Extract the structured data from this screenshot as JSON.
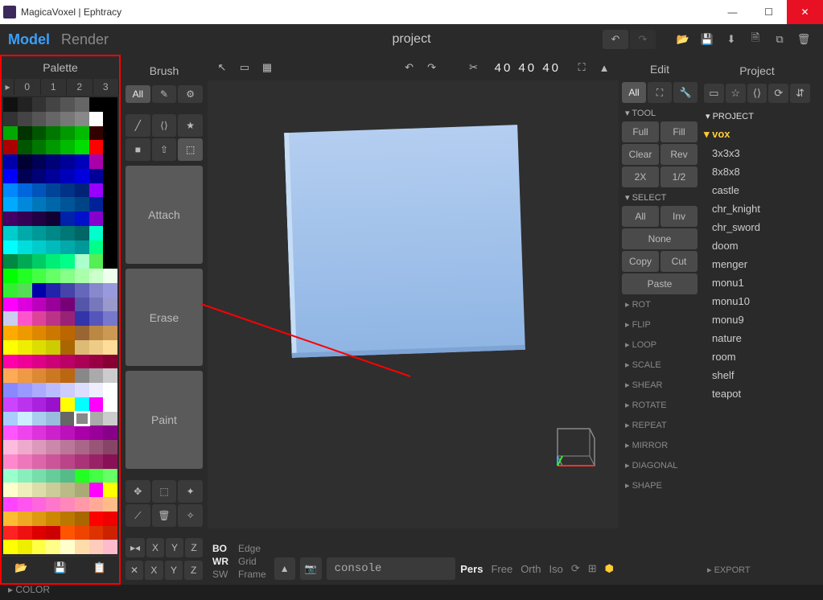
{
  "window": {
    "title": "MagicaVoxel | Ephtracy"
  },
  "menubar": {
    "tabs": [
      "Model",
      "Render"
    ],
    "project_name": "project"
  },
  "palette": {
    "title": "Palette",
    "tabs": [
      "0",
      "1",
      "2",
      "3"
    ],
    "footer_section": "COLOR",
    "selected_index": 181,
    "swatches": [
      "#111",
      "#222",
      "#333",
      "#444",
      "#555",
      "#666",
      "#000",
      "#000",
      "#333",
      "#444",
      "#555",
      "#666",
      "#777",
      "#888",
      "#fff",
      "#000",
      "#0a0",
      "#030",
      "#050",
      "#070",
      "#090",
      "#0b0",
      "#300",
      "#000",
      "#a00",
      "#050",
      "#070",
      "#090",
      "#0b0",
      "#0d0",
      "#f00",
      "#000",
      "#00a",
      "#003",
      "#005",
      "#007",
      "#009",
      "#00b",
      "#a0a",
      "#000",
      "#00f",
      "#005",
      "#007",
      "#009",
      "#00b",
      "#00d",
      "#009",
      "#000",
      "#08f",
      "#06d",
      "#05b",
      "#049",
      "#038",
      "#027",
      "#90f",
      "#000",
      "#0af",
      "#08d",
      "#07b",
      "#06a",
      "#059",
      "#048",
      "#029",
      "#000",
      "#406",
      "#305",
      "#204",
      "#103",
      "#02a",
      "#01c",
      "#80c",
      "#000",
      "#0cc",
      "#0aa",
      "#099",
      "#088",
      "#077",
      "#066",
      "#0fc",
      "#000",
      "#0ff",
      "#0dd",
      "#0cc",
      "#0bb",
      "#0aa",
      "#099",
      "#0f8",
      "#000",
      "#084",
      "#0a5",
      "#0c6",
      "#0e7",
      "#0f8",
      "#afc",
      "#5e5",
      "#000",
      "#0f0",
      "#2f2",
      "#4f4",
      "#6f6",
      "#8f8",
      "#afa",
      "#cfc",
      "#efe",
      "#3e3",
      "#5d5",
      "#00a",
      "#22a",
      "#44a",
      "#66b",
      "#88c",
      "#99d",
      "#f0f",
      "#d0d",
      "#b0b",
      "#909",
      "#707",
      "#55a",
      "#77b",
      "#99c",
      "#cce",
      "#f5c",
      "#d49",
      "#b38",
      "#927",
      "#33a",
      "#55b",
      "#77c",
      "#fa0",
      "#e90",
      "#d80",
      "#c70",
      "#b60",
      "#963",
      "#b84",
      "#c95",
      "#ff0",
      "#ee0",
      "#dd0",
      "#cc0",
      "#a60",
      "#db7",
      "#ec8",
      "#fd9",
      "#f0a",
      "#e09",
      "#d08",
      "#c07",
      "#b06",
      "#a05",
      "#904",
      "#803",
      "#fa5",
      "#e94",
      "#d83",
      "#c72",
      "#b61",
      "#888",
      "#aaa",
      "#ccc",
      "#88f",
      "#99f",
      "#aaf",
      "#bbf",
      "#ccf",
      "#ddf",
      "#eef",
      "#fff",
      "#c4f",
      "#b3e",
      "#a2d",
      "#91c",
      "#ff0",
      "#0ff",
      "#f0f",
      "#fff",
      "#acf",
      "#cef",
      "#ace",
      "#9bd",
      "#666",
      "#888",
      "#aaa",
      "#ccc",
      "#f5f",
      "#e4e",
      "#d3d",
      "#c2c",
      "#b1b",
      "#a0a",
      "#909",
      "#808",
      "#fbd",
      "#eac",
      "#d9b",
      "#c8a",
      "#b79",
      "#a68",
      "#957",
      "#846",
      "#f8c",
      "#e7b",
      "#d6a",
      "#c59",
      "#b48",
      "#a37",
      "#926",
      "#815",
      "#9fc",
      "#8eb",
      "#7da",
      "#6c9",
      "#5b8",
      "#2f2",
      "#4f4",
      "#6f6",
      "#ffc",
      "#eeb",
      "#dda",
      "#cc9",
      "#bb8",
      "#aa7",
      "#f0f",
      "#ff0",
      "#f4f",
      "#f5e",
      "#f6d",
      "#f7c",
      "#f8b",
      "#f9a",
      "#fa9",
      "#fb8",
      "#fb3",
      "#ea2",
      "#d91",
      "#c80",
      "#b70",
      "#a60",
      "#f00",
      "#e00",
      "#f22",
      "#e11",
      "#d00",
      "#c00",
      "#f50",
      "#e40",
      "#d30",
      "#c20",
      "#ff0",
      "#ee0",
      "#ff4",
      "#ff8",
      "#ffc",
      "#fda",
      "#fcb",
      "#fbc"
    ]
  },
  "brush": {
    "title": "Brush",
    "all": "All",
    "modes": {
      "attach": "Attach",
      "erase": "Erase",
      "paint": "Paint"
    },
    "axes_labels": [
      "X",
      "Y",
      "Z"
    ]
  },
  "viewport": {
    "dims": "40 40 40",
    "console_label": "console",
    "view_modes": [
      "Pers",
      "Free",
      "Orth",
      "Iso"
    ],
    "stats": {
      "bo": "BO",
      "edge": "Edge",
      "wr": "WR",
      "grid": "Grid",
      "sw": "SW",
      "frame": "Frame"
    }
  },
  "edit": {
    "title": "Edit",
    "all": "All",
    "sections": {
      "tool": {
        "label": "TOOL",
        "buttons": {
          "full": "Full",
          "fill": "Fill",
          "clear": "Clear",
          "rev": "Rev",
          "x2": "2X",
          "half": "1/2"
        }
      },
      "select": {
        "label": "SELECT",
        "buttons": {
          "all": "All",
          "inv": "Inv",
          "none": "None",
          "copy": "Copy",
          "cut": "Cut",
          "paste": "Paste"
        }
      }
    },
    "collapsed": [
      "ROT",
      "FLIP",
      "LOOP",
      "SCALE",
      "SHEAR",
      "ROTATE",
      "REPEAT",
      "MIRROR",
      "DIAGONAL",
      "SHAPE"
    ]
  },
  "project": {
    "title": "Project",
    "header": "PROJECT",
    "active": "vox",
    "items": [
      "3x3x3",
      "8x8x8",
      "castle",
      "chr_knight",
      "chr_sword",
      "doom",
      "menger",
      "monu1",
      "monu10",
      "monu9",
      "nature",
      "room",
      "shelf",
      "teapot"
    ],
    "export": "EXPORT"
  }
}
